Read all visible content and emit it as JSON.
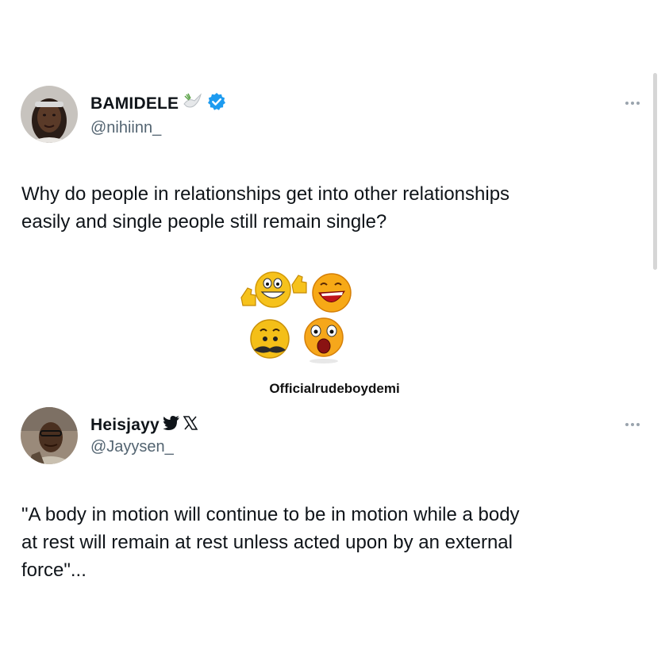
{
  "tweet1": {
    "display_name": "BAMIDELE",
    "handle": "@nihiinn_",
    "text_line1": "Why do people in relationships get into other relationships",
    "text_line2": "easily and single people still remain single?",
    "icons": [
      "dove-icon",
      "verified-badge-icon",
      "more-options-icon"
    ]
  },
  "emoji_group": {
    "icons": [
      "thumbs-up-grin-emoji",
      "laughing-emoji",
      "mustache-emoji",
      "shocked-emoji"
    ]
  },
  "watermark": "Officialrudeboydemi",
  "tweet2": {
    "display_name": "Heisjayy",
    "handle": "@Jayysen_",
    "text_line1": "\"A body in motion will continue to be in motion while a body",
    "text_line2": "at rest will remain at rest unless acted upon by an external",
    "text_line3": "force\"...",
    "icons": [
      "bird-icon",
      "x-logo-icon",
      "more-options-icon"
    ]
  },
  "colors": {
    "verified": "#1d9bf0",
    "text": "#0f1419",
    "secondary": "#536471"
  }
}
